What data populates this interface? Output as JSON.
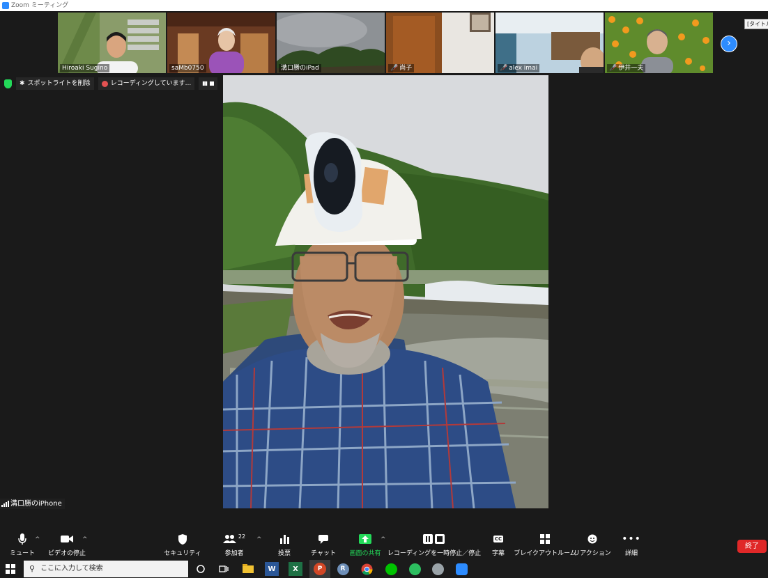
{
  "window": {
    "title": "Zoom ミーティング"
  },
  "participants_strip": {
    "tiles": [
      {
        "name": "Hiroaki Sugino",
        "muted": false
      },
      {
        "name": "saMb0750",
        "muted": false
      },
      {
        "name": "溝口勝のiPad",
        "muted": false
      },
      {
        "name": "尚子",
        "muted": true
      },
      {
        "name": "alex imai",
        "muted": true
      },
      {
        "name": "伊井一夫",
        "muted": true
      }
    ],
    "tooltip": "[タイトル"
  },
  "meeting_bar": {
    "spotlight_label": "スポットライトを削除",
    "recording_label": "レコーディングしています..."
  },
  "active_speaker": {
    "name": "溝口勝のiPhone"
  },
  "controls": {
    "mute": "ミュート",
    "video": "ビデオの停止",
    "security": "セキュリティ",
    "participants": "参加者",
    "participants_count": "22",
    "polls": "投票",
    "chat": "チャット",
    "share": "画面の共有",
    "recording": "レコーディングを一時停止／停止",
    "captions": "字幕",
    "captions_icon_text": "CC",
    "breakout": "ブレイクアウトルーム",
    "reactions": "リアクション",
    "more": "詳細",
    "end": "終了"
  },
  "taskbar": {
    "search_placeholder": "ここに入力して検索",
    "apps": [
      "file-explorer-icon",
      "word-icon",
      "excel-icon",
      "powerpoint-icon",
      "r-icon",
      "chrome-icon",
      "line-icon",
      "evernote-icon",
      "app-icon",
      "zoom-icon"
    ]
  },
  "colors": {
    "accent": "#2d8cff",
    "end": "#e02828",
    "share": "#23d959"
  }
}
